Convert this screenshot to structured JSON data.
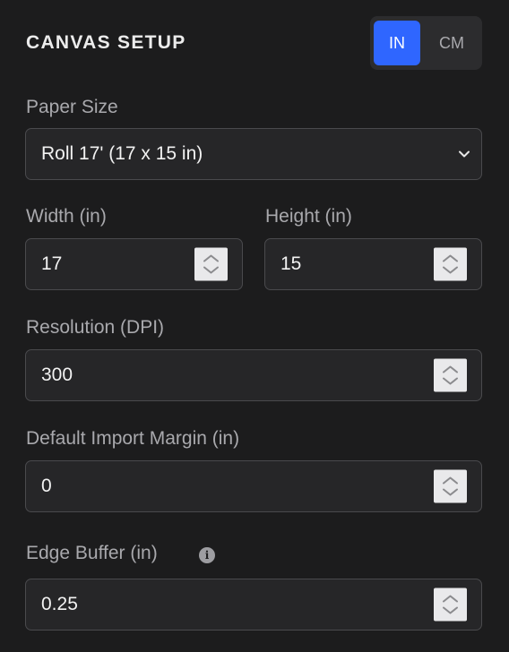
{
  "header": {
    "title": "CANVAS SETUP",
    "unit_toggle": {
      "options": [
        "IN",
        "CM"
      ],
      "selected": "IN",
      "accent_color": "#2f66ff"
    }
  },
  "fields": {
    "paper_size": {
      "label": "Paper Size",
      "value": "Roll 17' (17 x 15 in)",
      "icon": "chevron-down-icon"
    },
    "width": {
      "label": "Width (in)",
      "value": "17"
    },
    "height": {
      "label": "Height (in)",
      "value": "15"
    },
    "resolution": {
      "label": "Resolution (DPI)",
      "value": "300"
    },
    "import_margin": {
      "label": "Default Import Margin (in)",
      "value": "0"
    },
    "edge_buffer": {
      "label": "Edge Buffer (in)",
      "value": "0.25",
      "info_icon": "info-icon"
    }
  }
}
